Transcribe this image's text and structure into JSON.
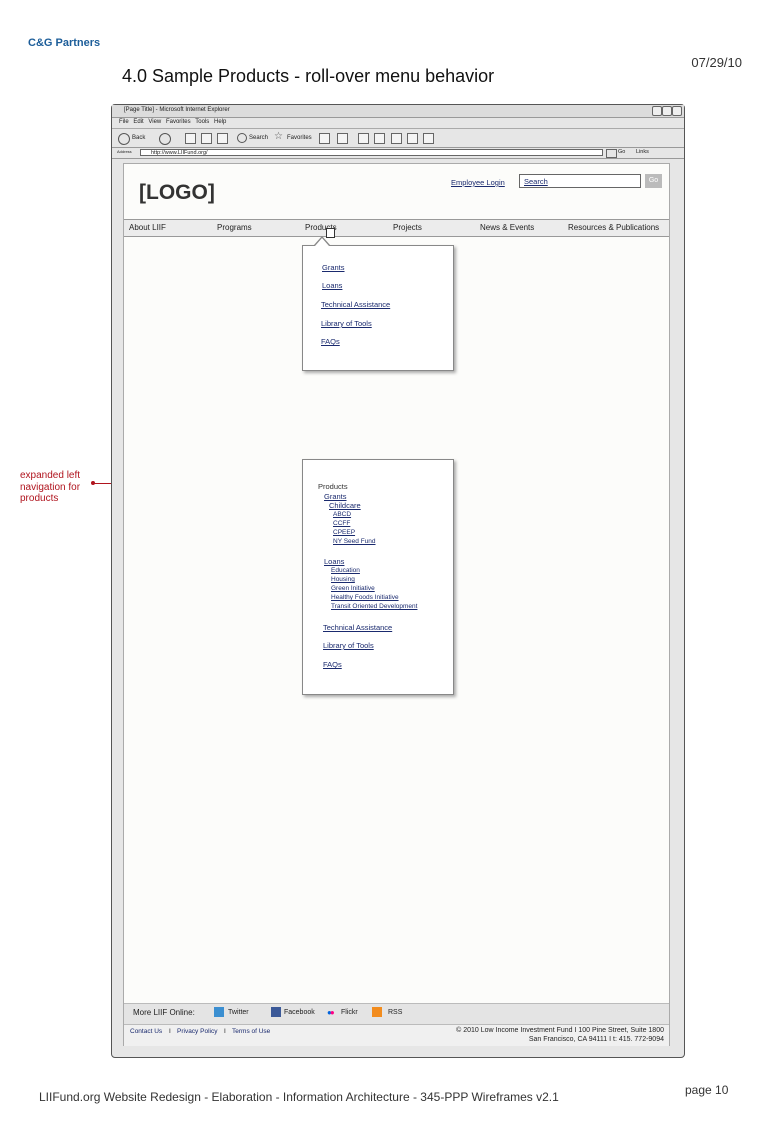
{
  "doc": {
    "company": "C&G Partners",
    "date": "07/29/10",
    "title": "4.0 Sample Products - roll-over menu behavior",
    "footer": "LIIFund.org Website Redesign  - Elaboration - Information Architecture - 345-PPP Wireframes v2.1",
    "page": "page 10"
  },
  "browser": {
    "window_title": "[Page Title] - Microsoft Internet Explorer",
    "menu": [
      "File",
      "Edit",
      "View",
      "Favorites",
      "Tools",
      "Help"
    ],
    "toolbar": {
      "back": "Back",
      "search": "Search",
      "favorites": "Favorites"
    },
    "address_label": "Address",
    "url": "http://www.LIIFund.org/",
    "go": "Go",
    "links": "Links"
  },
  "site": {
    "logo": "[LOGO]",
    "employee_login": "Employee Login",
    "search_value": "Search",
    "go_button": "Go",
    "nav": [
      "About LIIF",
      "Programs",
      "Products",
      "Projects",
      "News & Events",
      "Resources & Publications"
    ],
    "dropdown": [
      "Grants",
      "Loans",
      "Technical Assistance",
      "Library of Tools",
      "FAQs"
    ],
    "leftnav": {
      "heading": "Products",
      "grants": "Grants",
      "childcare": "Childcare",
      "childcare_items": [
        "ABCD",
        "CCFF",
        "CPEEP",
        "NY Seed Fund"
      ],
      "loans": "Loans",
      "loan_items": [
        "Education",
        "Housing",
        "Green Initiative",
        "Healthy Foods Initiative",
        "Transit Oriented Development"
      ],
      "technical_assistance": "Technical Assistance",
      "library": "Library of Tools",
      "faqs": "FAQs"
    },
    "social": {
      "label": "More LIIF Online:",
      "twitter": "Twitter",
      "facebook": "Facebook",
      "flickr": "Flickr",
      "rss": "RSS"
    },
    "footer_links": [
      "Contact Us",
      "Privacy Policy",
      "Terms of Use"
    ],
    "footer_separator": "I",
    "copyright_line1": "© 2010 Low Income Investment Fund I 100 Pine Street, Suite 1800",
    "copyright_line2": "San Francisco, CA 94111 I t: 415. 772-9094"
  },
  "annotation": {
    "line1": "expanded left",
    "line2": "navigation for",
    "line3": "products"
  },
  "colors": {
    "annotation": "#b0141e",
    "link": "#1a2a6e",
    "brand": "#1c5d99"
  }
}
